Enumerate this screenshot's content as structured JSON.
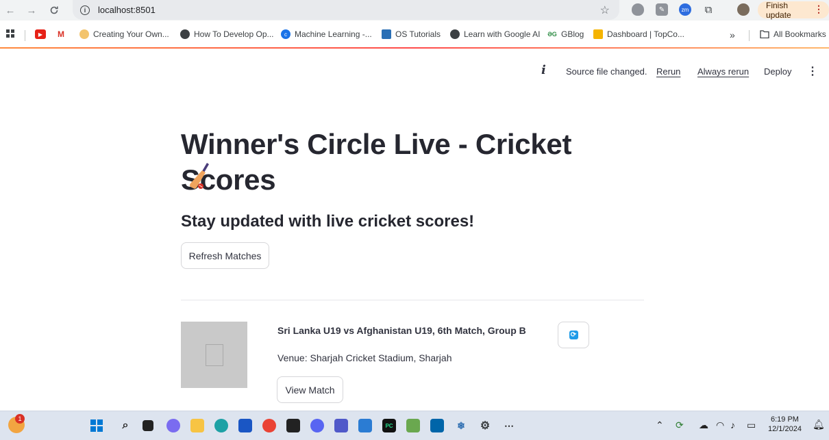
{
  "browser": {
    "url": "localhost:8501",
    "finish_update_label": "Finish update",
    "bookmarks": [
      {
        "label": "Creating Your Own..."
      },
      {
        "label": "How To Develop Op..."
      },
      {
        "label": "Machine Learning -..."
      },
      {
        "label": "OS Tutorials"
      },
      {
        "label": "Learn with Google AI"
      },
      {
        "label": "GBlog"
      },
      {
        "label": "Dashboard | TopCo..."
      }
    ],
    "overflow_label": "»",
    "all_bookmarks_label": "All Bookmarks"
  },
  "streamlit_header": {
    "status_text": "Source file changed.",
    "rerun_label": "Rerun",
    "always_rerun_label": "Always rerun",
    "deploy_label": "Deploy"
  },
  "main": {
    "title": "Winner's Circle Live - Cricket Scores",
    "subtitle": "Stay updated with live cricket scores!",
    "refresh_button_label": "Refresh Matches",
    "matches": [
      {
        "title": "Sri Lanka U19 vs Afghanistan U19, 6th Match, Group B",
        "venue": "Venue: Sharjah Cricket Stadium, Sharjah",
        "view_button_label": "View Match"
      }
    ]
  },
  "taskbar": {
    "weather_badge": "1",
    "time": "6:19 PM",
    "date": "12/1/2024"
  },
  "colors": {
    "accent_gradient_start": "#ff8a3d",
    "accent_gradient_mid": "#ff4b4b",
    "sync_icon": "#1e9be8"
  }
}
